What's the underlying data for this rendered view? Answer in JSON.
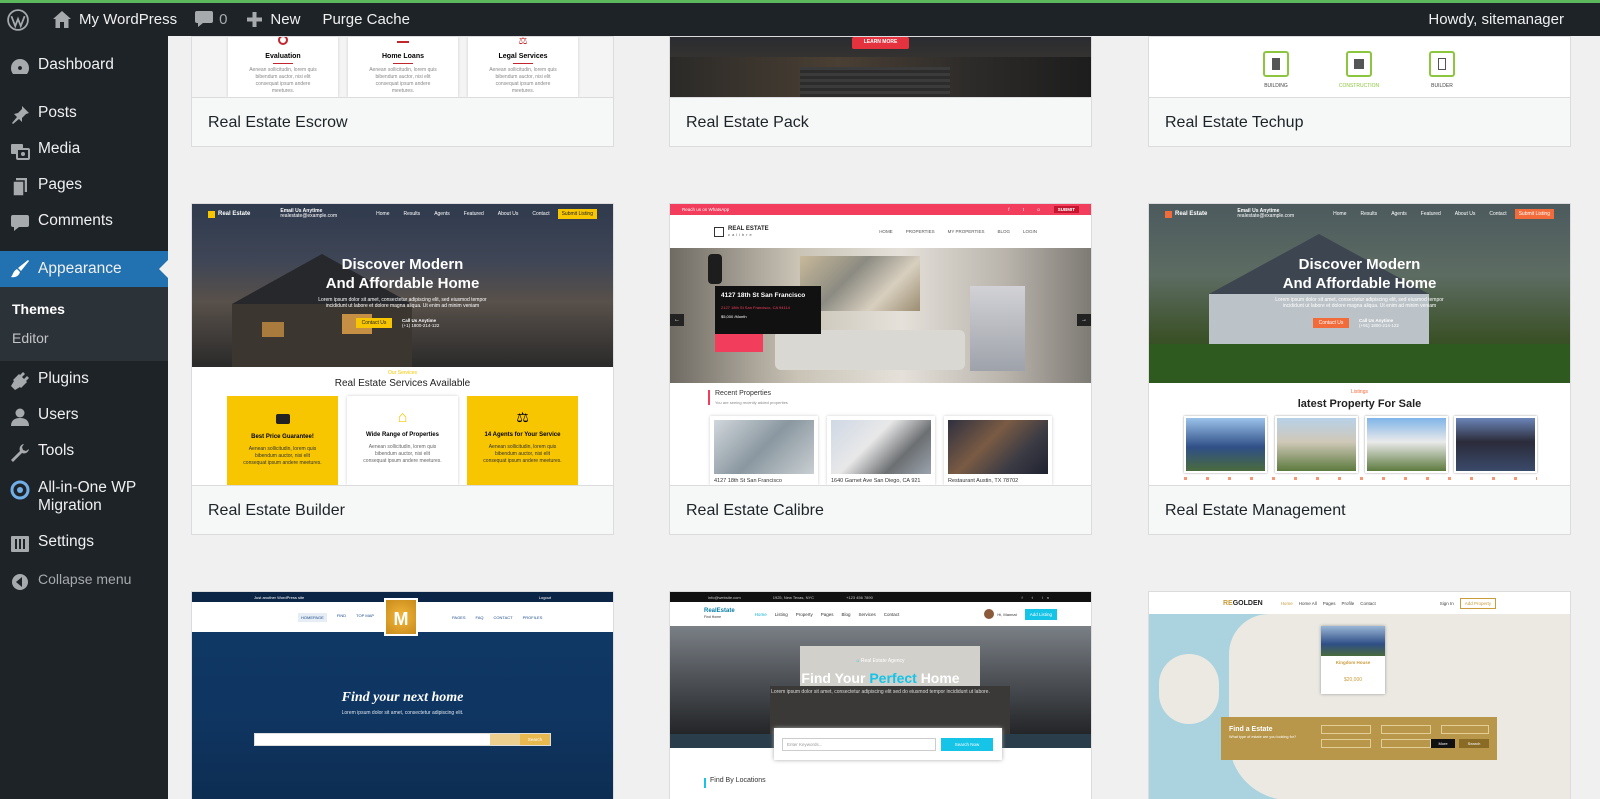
{
  "admin_bar": {
    "site_name": "My WordPress",
    "comments_count": "0",
    "new_label": "New",
    "purge_label": "Purge Cache",
    "greeting": "Howdy, sitemanager"
  },
  "sidebar": {
    "dashboard": "Dashboard",
    "posts": "Posts",
    "media": "Media",
    "pages": "Pages",
    "comments": "Comments",
    "appearance": "Appearance",
    "themes": "Themes",
    "editor": "Editor",
    "plugins": "Plugins",
    "users": "Users",
    "tools": "Tools",
    "aiowpm_line1": "All-in-One WP",
    "aiowpm_line2": "Migration",
    "settings": "Settings",
    "collapse": "Collapse menu"
  },
  "themes": [
    {
      "name": "Real Estate Escrow"
    },
    {
      "name": "Real Estate Pack"
    },
    {
      "name": "Real Estate Techup"
    },
    {
      "name": "Real Estate Builder"
    },
    {
      "name": "Real Estate Calibre"
    },
    {
      "name": "Real Estate Management"
    }
  ],
  "previews": {
    "escrow": {
      "s1": "Evaluation",
      "s2": "Home Loans",
      "s3": "Legal Services",
      "body": "Aenean sollicitudin, lorem quis bibendum auctor, nisi elit consequat ipsum andere meetures."
    },
    "pack": {
      "button": "LEARN MORE"
    },
    "techup": {
      "i1": "BUILDING",
      "i2": "CONSTRUCTION",
      "i3": "BUILDER"
    },
    "builder": {
      "logo": "Real Estate",
      "contact_label": "Email Us Anytime",
      "contact_value": "realestate@example.com",
      "nav": [
        "Home",
        "Results",
        "Agents",
        "Featured",
        "About Us",
        "Contact"
      ],
      "submit": "Submit Listing",
      "title1": "Discover Modern",
      "title2": "And Affordable Home",
      "subtitle": "Lorem ipsum dolor sit amet, consectetur adipiscing elit, sed eiusmod tempor incididunt ut labore et dolore magna aliqua. Ut enim ad minim veniam",
      "cta": "Contact Us",
      "call_label": "Call Us Anytime",
      "call_value": "(+1) 1800-214-122",
      "services_kicker": "Our Services",
      "services_title": "Real Estate Services Available",
      "f1": "Best Price Guarantee!",
      "f2": "Wide Range of Properties",
      "f3": "14 Agents for Your Service",
      "body": "Aenean sollicitudin, lorem quis bibendum auctor, nisi elit consequat ipsum andere meetures."
    },
    "calibre": {
      "top_bar": "Reach us on WhatsApp",
      "submit": "SUBMIT",
      "logo": "REAL ESTATE",
      "logo_sub": "calibre",
      "nav": [
        "HOME",
        "PROPERTIES",
        "MY PROPERTIES",
        "BLOG",
        "LOGIN"
      ],
      "overlay_title": "4127 18th St San Francisco",
      "overlay_addr": "2127 18th St San Francisco, CA 94114",
      "overlay_price": "$5,000 /Month",
      "recent_title": "Recent Properties",
      "recent_sub": "You are seeing recently added properties",
      "cards": [
        "4127 18th St San Francisco",
        "1640 Garnet Ave San Diego, CA 921",
        "Restaurant Austin, TX 78702"
      ]
    },
    "management": {
      "logo": "Real Estate",
      "contact_label": "Email Us Anytime",
      "contact_value": "realestate@example.com",
      "nav": [
        "Home",
        "Results",
        "Agents",
        "Featured",
        "About Us",
        "Contact"
      ],
      "submit": "Submit Listing",
      "title1": "Discover Modern",
      "title2": "And Affordable Home",
      "subtitle": "Lorem ipsum dolor sit amet, consectetur adipiscing elit, sed eiusmod tempor incididunt ut labore et dolore magna aliqua. Ut enim ad minim veniam",
      "cta": "Contact Us",
      "call_label": "Call Us Anytime",
      "call_value": "(+91) 1800-214-122",
      "kicker": "Listings",
      "section_title": "latest Property For Sale"
    },
    "m7": {
      "top_bar": "Just another WordPress site",
      "login": "Logout",
      "nav_left": [
        "HOMEPAGE",
        "FIND",
        "TOP MAP"
      ],
      "nav_right": [
        "PAGES",
        "FAQ",
        "CONTACT",
        "PROFILES"
      ],
      "headline": "Find your next home",
      "sub": "Lorem ipsum dolor sit amet, consectetur adipiscing elit.",
      "search_btn": "Search"
    },
    "agency": {
      "email": "info@website.com",
      "address": "1925, New Texas, NYC",
      "phone": "+123 456 7890",
      "logo": "RealEstate",
      "logo_sub": "Find Home",
      "nav": [
        "Home",
        "Listing",
        "Property",
        "Pages",
        "Blog",
        "Services",
        "Contact"
      ],
      "user": "Hi, Mannat",
      "add_listing": "Add Listing",
      "kicker": "Real Estate Agency",
      "h_find": "Find Your",
      "h_perfect": "Perfect",
      "h_home": "Home",
      "sub": "Lorem ipsum dolor sit amet, consectetur adipiscing elit sed do eiusmod tempor incididunt ut labore.",
      "search_placeholder": "Enter Keywords...",
      "search_btn": "Search Now",
      "find_by": "Find By Locations"
    },
    "golden": {
      "logo_re": "RE",
      "logo_golden": "GOLDEN",
      "nav": [
        "Home",
        "Home All",
        "Pages",
        "Profile",
        "Contact"
      ],
      "sign_in": "Sign In",
      "add_property": "Add Property",
      "pin_title": "Kingdom House",
      "pin_price": "$20,000",
      "find_title": "Find a Estate",
      "find_sub": "What type of estate are you looking for?",
      "more": "More",
      "search": "Search"
    }
  }
}
